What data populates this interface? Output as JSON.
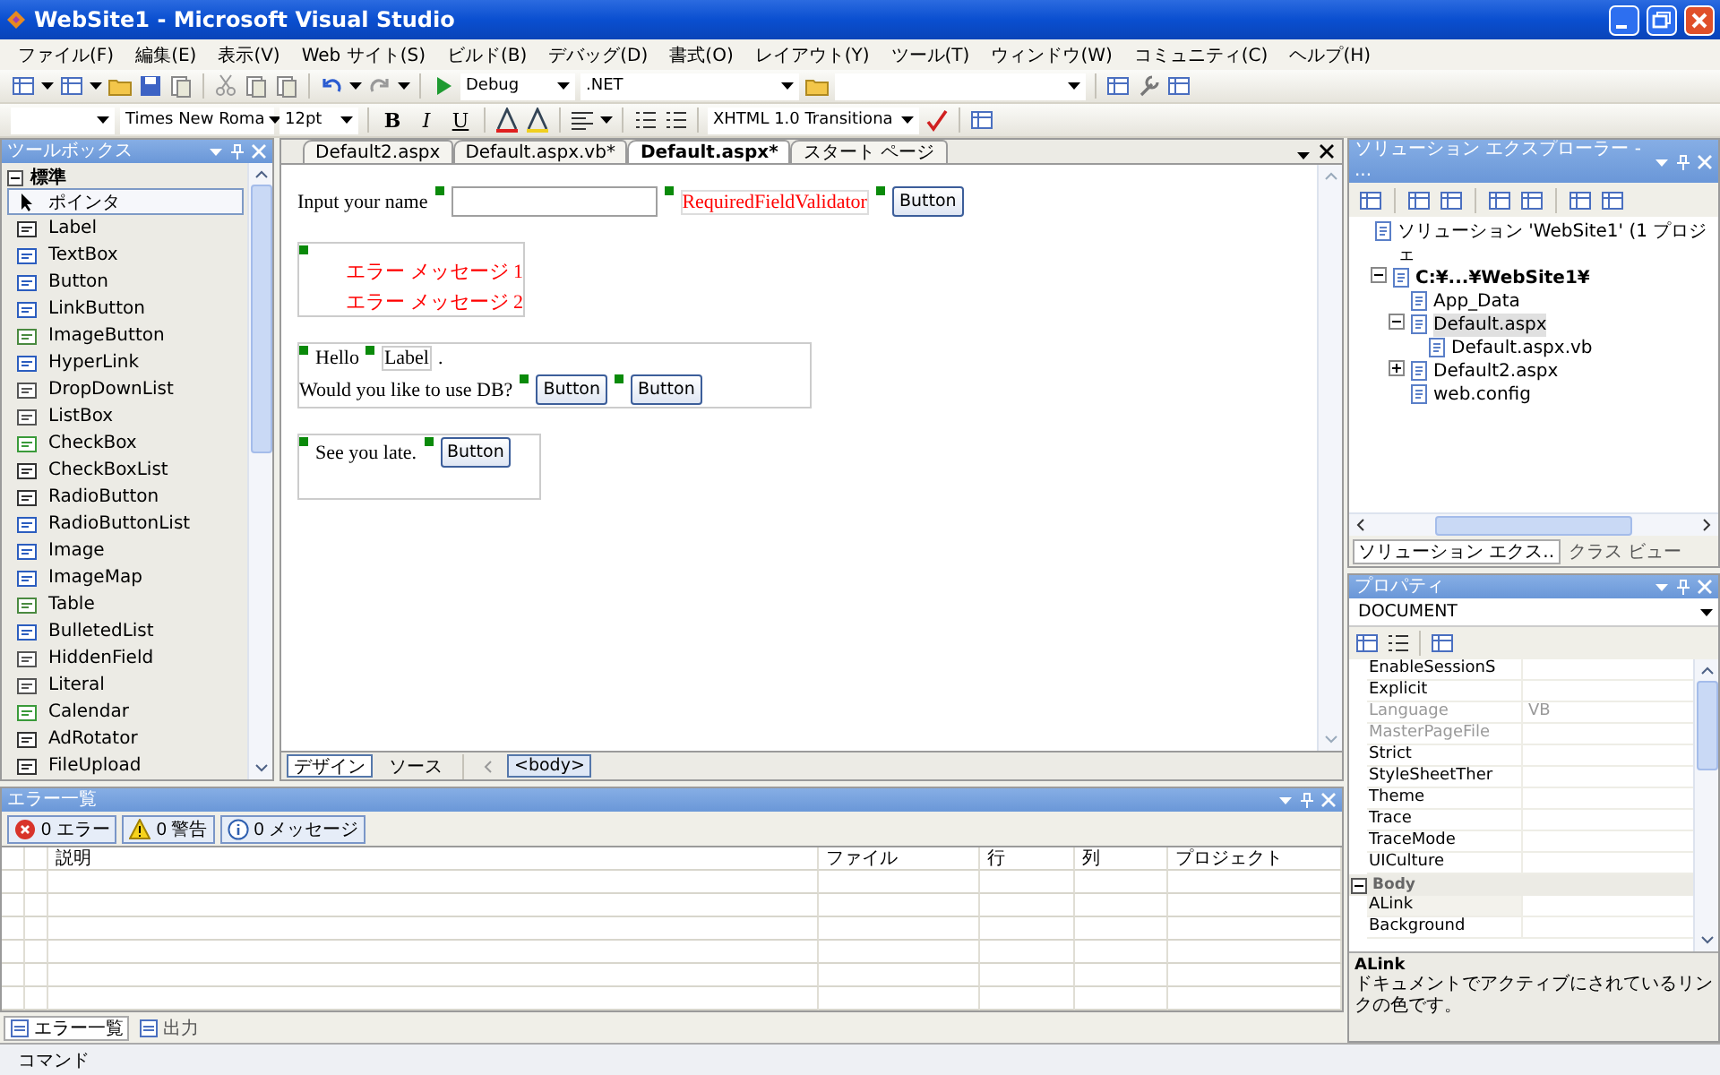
{
  "window": {
    "title": "WebSite1 - Microsoft Visual Studio"
  },
  "menu": [
    "ファイル(F)",
    "編集(E)",
    "表示(V)",
    "Web サイト(S)",
    "ビルド(B)",
    "デバッグ(D)",
    "書式(O)",
    "レイアウト(Y)",
    "ツール(T)",
    "ウィンドウ(W)",
    "コミュニティ(C)",
    "ヘルプ(H)"
  ],
  "toolbar1": {
    "configuration": "Debug",
    "platform": ".NET"
  },
  "toolbar2": {
    "font": "Times New Roma",
    "size": "12pt",
    "bold": "B",
    "italic": "I",
    "underline": "U",
    "schema": "XHTML 1.0 Transitiona"
  },
  "toolbox": {
    "title": "ツールボックス",
    "group": {
      "label": "標準",
      "expanded": true
    },
    "items": [
      {
        "label": "ポインタ",
        "selected": true
      },
      {
        "label": "Label",
        "selected": false
      },
      {
        "label": "TextBox",
        "selected": false
      },
      {
        "label": "Button",
        "selected": false
      },
      {
        "label": "LinkButton",
        "selected": false
      },
      {
        "label": "ImageButton",
        "selected": false
      },
      {
        "label": "HyperLink",
        "selected": false
      },
      {
        "label": "DropDownList",
        "selected": false
      },
      {
        "label": "ListBox",
        "selected": false
      },
      {
        "label": "CheckBox",
        "selected": false
      },
      {
        "label": "CheckBoxList",
        "selected": false
      },
      {
        "label": "RadioButton",
        "selected": false
      },
      {
        "label": "RadioButtonList",
        "selected": false
      },
      {
        "label": "Image",
        "selected": false
      },
      {
        "label": "ImageMap",
        "selected": false
      },
      {
        "label": "Table",
        "selected": false
      },
      {
        "label": "BulletedList",
        "selected": false
      },
      {
        "label": "HiddenField",
        "selected": false
      },
      {
        "label": "Literal",
        "selected": false
      },
      {
        "label": "Calendar",
        "selected": false
      },
      {
        "label": "AdRotator",
        "selected": false
      },
      {
        "label": "FileUpload",
        "selected": false
      }
    ]
  },
  "editor": {
    "tabs": [
      {
        "label": "Default2.aspx",
        "selected": false
      },
      {
        "label": "Default.aspx.vb*",
        "selected": false
      },
      {
        "label": "Default.aspx*",
        "selected": true
      },
      {
        "label": "スタート ページ",
        "selected": false
      }
    ],
    "design": {
      "prompt": "Input your name",
      "validator": "RequiredFieldValidator",
      "submit": "Button",
      "errors": [
        "エラー メッセージ 1",
        "エラー メッセージ 2"
      ],
      "hello": "Hello",
      "label": "Label",
      "period": ".",
      "question": "Would you like to use DB?",
      "choices": [
        "Button",
        "Button"
      ],
      "farewell": "See you late.",
      "farewell_button": "Button"
    },
    "views": [
      {
        "label": "デザイン",
        "selected": true
      },
      {
        "label": "ソース",
        "selected": false
      }
    ],
    "tag": "<body>"
  },
  "solution_explorer": {
    "title": "ソリューション エクスプローラー - ...",
    "tree": [
      {
        "label": "ソリューション 'WebSite1' (1 プロジェ",
        "children": [
          {
            "label": "C:¥...¥WebSite1¥",
            "expanded": true,
            "bold": true,
            "children": [
              {
                "label": "App_Data"
              },
              {
                "label": "Default.aspx",
                "expanded": true,
                "selected": true,
                "children": [
                  {
                    "label": "Default.aspx.vb"
                  }
                ]
              },
              {
                "label": "Default2.aspx",
                "expanded": false
              },
              {
                "label": "web.config"
              }
            ]
          }
        ]
      }
    ],
    "tabs": [
      {
        "label": "ソリューション エクス..",
        "selected": true
      },
      {
        "label": "クラス ビュー",
        "selected": false
      }
    ]
  },
  "properties": {
    "title": "プロパティ",
    "object": "DOCUMENT",
    "rows": [
      {
        "kind": "property",
        "name": "EnableSessionS"
      },
      {
        "kind": "property",
        "name": "Explicit"
      },
      {
        "kind": "property",
        "name": "Language",
        "value": "VB",
        "disabled": true
      },
      {
        "kind": "property",
        "name": "MasterPageFile",
        "disabled": true
      },
      {
        "kind": "property",
        "name": "Strict"
      },
      {
        "kind": "property",
        "name": "StyleSheetTher"
      },
      {
        "kind": "property",
        "name": "Theme"
      },
      {
        "kind": "property",
        "name": "Trace"
      },
      {
        "kind": "property",
        "name": "TraceMode"
      },
      {
        "kind": "property",
        "name": "UICulture"
      },
      {
        "kind": "category",
        "name": "Body",
        "expanded": true
      },
      {
        "kind": "property",
        "name": "ALink",
        "selected": true
      },
      {
        "kind": "property",
        "name": "Background"
      }
    ],
    "description": {
      "title": "ALink",
      "text": "ドキュメントでアクティブにされているリンクの色です。"
    }
  },
  "error_list": {
    "title": "エラー一覧",
    "filters": [
      {
        "kind": "error",
        "label": "0 エラー"
      },
      {
        "kind": "warning",
        "label": "0 警告"
      },
      {
        "kind": "info",
        "label": "0 メッセージ"
      }
    ],
    "columns": [
      "説明",
      "ファイル",
      "行",
      "列",
      "プロジェクト"
    ]
  },
  "bottom_tabs": [
    {
      "label": "エラー一覧",
      "selected": true
    },
    {
      "label": "出力",
      "selected": false
    }
  ],
  "status_bar": "コマンド"
}
